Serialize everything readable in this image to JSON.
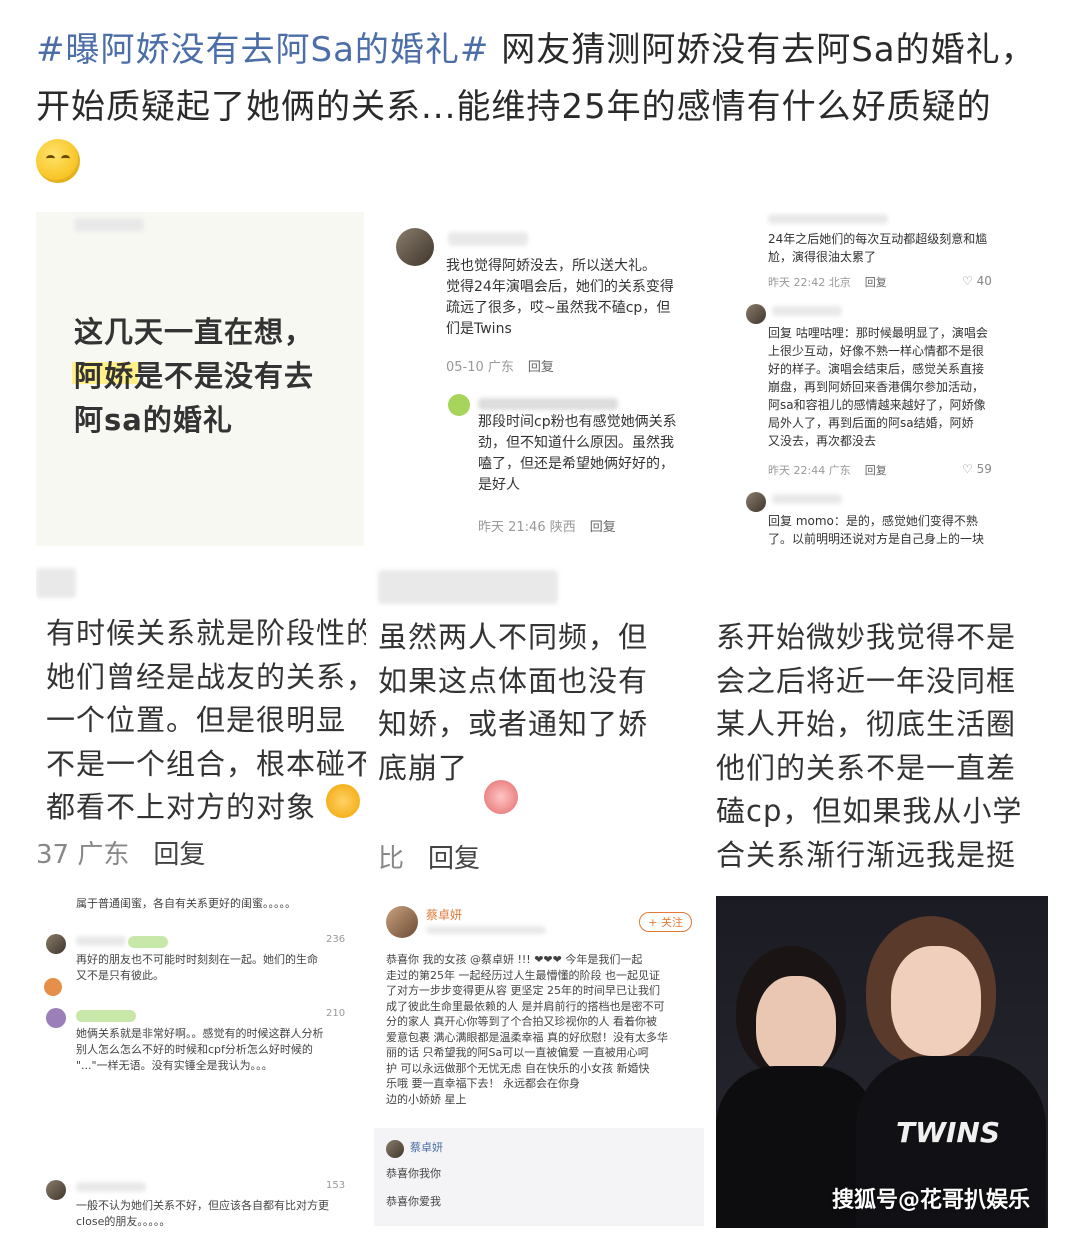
{
  "header": {
    "hashtag": "#曝阿娇没有去阿Sa的婚礼#",
    "text": " 网友猜测阿娇没有去阿Sa的婚礼，开始质疑起了她俩的关系...能维持25年的感情有什么好质疑的"
  },
  "panel1": {
    "text": "这几天一直在想，\n阿娇是不是没有去\n阿sa的婚礼"
  },
  "panel2": {
    "comment1": "我也觉得阿娇没去，所以送大礼。\n觉得24年演唱会后，她们的关系变得\n疏远了很多，哎~虽然我不磕cp，但\n们是Twins",
    "meta1": "05-10 广东",
    "reply_label": "回复",
    "comment2": "那段时间cp粉也有感觉她俩关系\n劲，但不知道什么原因。虽然我\n嗑了，但还是希望她俩好好的，\n是好人",
    "meta2": "昨天 21:46 陕西"
  },
  "panel3": {
    "text1": "24年之后她们的每次互动都超级刻意和尴\n尬，演得很油太累了",
    "meta1": "昨天 22:42 北京",
    "reply_label": "回复",
    "likes1": "♡ 40",
    "text2": "回复 咕哩咕哩：那时候最明显了，演唱会\n上很少互动，好像不熟一样心情都不是很\n好的样子。演唱会结束后，感觉关系直接\n崩盘，再到阿娇回来香港偶尔参加活动，\n阿sa和容祖儿的感情越来越好了，阿娇像\n局外人了，再到后面的阿sa结婚，阿娇\n又没去，再次都没去",
    "meta2": "昨天 22:44 广东",
    "likes2": "♡ 59",
    "text3": "回复 momo：是的，感觉她们变得不熟\n了。以前明明还说对方是自己身上的一块"
  },
  "row2a": {
    "lines": "有时候关系就是阶段性的\n她们曾经是战友的关系，\n一个位置。但是很明显\n不是一个组合，根本碰不\n都看不上对方的对象",
    "meta": "37 广东",
    "reply_label": "回复"
  },
  "row2b": {
    "lines": "虽然两人不同频，但\n如果这点体面也没有\n知娇，或者通知了娇\n底崩了",
    "meta": "比",
    "reply_label": "回复"
  },
  "row2c": {
    "lines": "系开始微妙我觉得不是\n会之后将近一年没同框\n某人开始，彻底生活圈\n他们的关系不是一直差\n磕cp，但如果我从小学\n合关系渐行渐远我是挺"
  },
  "panel7": {
    "top": "属于普通闺蜜，各自有关系更好的闺蜜。。。。。",
    "c1": "再好的朋友也不可能时时刻刻在一起。她们的生命\n又不是只有彼此。",
    "c2": "她俩关系就是非常好啊。。感觉有的时候这群人分析\n别人怎么怎么不好的时候和cpf分析怎么好时候的\n\"...\"一样无语。没有实锤全是我认为。。。",
    "c3": "一般不认为她们关系不好，但应该各自都有比对方更\nclose的朋友。。。。。",
    "n1": "236",
    "n2": "210",
    "n3": "153"
  },
  "panel8": {
    "name": "蔡卓妍",
    "follow": "+ 关注",
    "body": "恭喜你 我的女孩 @蔡卓妍 !!! ❤❤❤ 今年是我们一起\n走过的第25年 一起经历过人生最懵懂的阶段 也一起见证\n了对方一步步变得更从容 更坚定 25年的时间早已让我们\n成了彼此生命里最依赖的人 是并肩前行的搭档也是密不可\n分的家人 真开心你等到了个合拍又珍视你的人 看着你被\n爱意包裹 满心满眼都是温柔幸福 真的好欣慰！没有太多华\n丽的话 只希望我的阿Sa可以一直被偏爱 一直被用心呵\n护 可以永远做那个无忧无虑 自在快乐的小女孩 新婚快\n乐哦 要一直幸福下去！ 永远都会在你身\n边的小娇娇 星上",
    "reply_name": "蔡卓妍",
    "reply1": "恭喜你我你",
    "reply2": "恭喜你爱我"
  },
  "panel9": {
    "shirt_text": "TWINS",
    "watermark": "搜狐号@花哥扒娱乐"
  }
}
